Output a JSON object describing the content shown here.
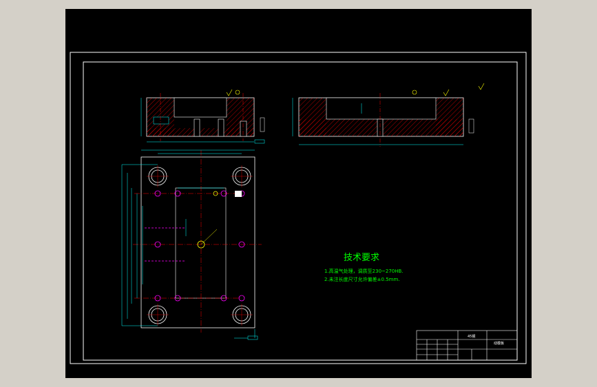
{
  "colors": {
    "background": "#d4d0c8",
    "canvas": "#000000",
    "frame": "#ffffff",
    "hatch": "#ff0000",
    "centerline": "#ff0000",
    "dimension": "#00ffff",
    "bolt_hole": "#ff00ff",
    "note_text": "#00ff00",
    "label_text": "#ffff00"
  },
  "technical_requirements": {
    "heading": "技术要求",
    "items": [
      "1.高温气处理，调质至230~270HB.",
      "2.未注长度尺寸允许偏差±0.5mm."
    ]
  },
  "title_block": {
    "drawing_name": "动模板",
    "material": "45钢"
  }
}
